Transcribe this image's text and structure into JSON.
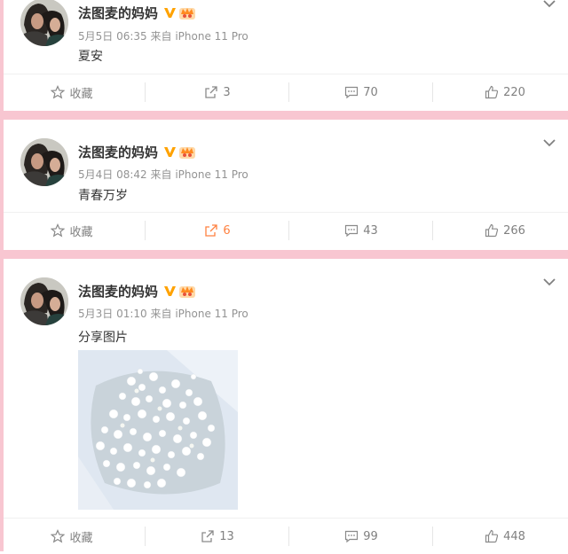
{
  "posts": [
    {
      "author": "法图麦的妈妈",
      "date": "5月5日 06:35",
      "source": "来自 iPhone 11 Pro",
      "text": "夏安",
      "actions": {
        "favorite": "收藏",
        "repost": "3",
        "comment": "70",
        "like": "220"
      }
    },
    {
      "author": "法图麦的妈妈",
      "date": "5月4日 08:42",
      "source": "来自 iPhone 11 Pro",
      "text": "青春万岁",
      "actions": {
        "favorite": "收藏",
        "repost": "6",
        "comment": "43",
        "like": "266"
      }
    },
    {
      "author": "法图麦的妈妈",
      "date": "5月3日 01:10",
      "source": "来自 iPhone 11 Pro",
      "text": "分享图片",
      "actions": {
        "favorite": "收藏",
        "repost": "13",
        "comment": "99",
        "like": "448"
      }
    }
  ],
  "colors": {
    "divider_pink": "#f8c6d1",
    "verified_orange": "#ffa200",
    "repost_active": "#ff8140",
    "meta_gray": "#939393"
  },
  "icons": [
    "star-icon",
    "repost-icon",
    "comment-icon",
    "like-icon",
    "chevron-down-icon",
    "verified-icon",
    "crown-badge-icon"
  ]
}
